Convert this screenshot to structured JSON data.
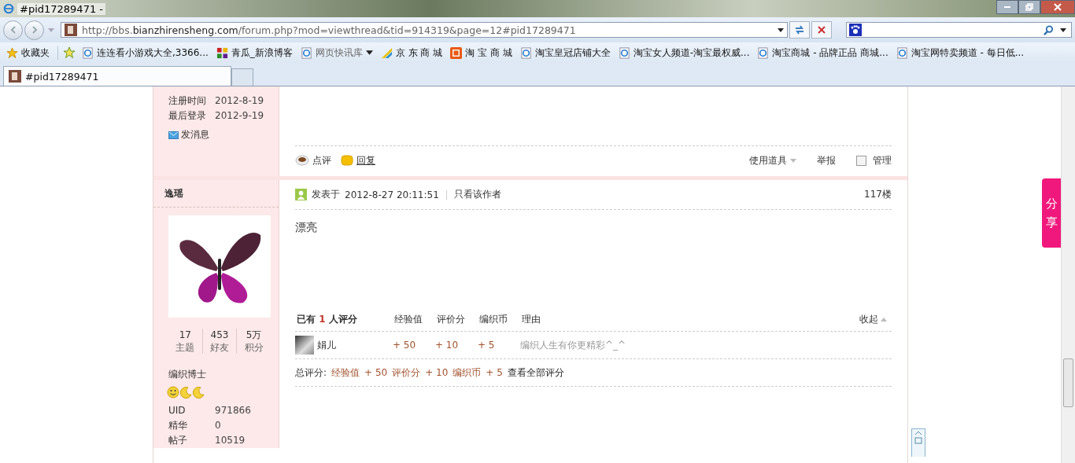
{
  "window": {
    "title": "#pid17289471 -"
  },
  "address_bar": {
    "url_prefix": "http://bbs.",
    "url_domain": "bianzhirensheng.com",
    "url_path": "/forum.php?mod=viewthread&tid=914319&page=12#pid17289471"
  },
  "favorites_bar": {
    "label": "收藏夹",
    "items": [
      {
        "kind": "page",
        "label": "连连看小游戏大全,3366..."
      },
      {
        "kind": "blocks",
        "label": "青瓜_新浪博客"
      },
      {
        "kind": "feed",
        "label": "网页快讯库"
      },
      {
        "kind": "stripes",
        "label": "京 东 商 城"
      },
      {
        "kind": "tao",
        "label": "淘 宝 商 城"
      },
      {
        "kind": "page",
        "label": "淘宝皇冠店铺大全"
      },
      {
        "kind": "page",
        "label": "淘宝女人频道-淘宝最权威..."
      },
      {
        "kind": "page",
        "label": "淘宝商城 - 品牌正品 商城..."
      },
      {
        "kind": "page",
        "label": "淘宝网特卖频道 - 每日低..."
      }
    ]
  },
  "tabs": [
    {
      "label": "#pid17289471",
      "selected": true
    }
  ],
  "previous_post": {
    "profile": [
      {
        "label": "注册时间",
        "value": "2012-8-19"
      },
      {
        "label": "最后登录",
        "value": "2012-9-19"
      }
    ],
    "message_link": "发消息",
    "actions": [
      {
        "kind": "comment",
        "label": "点评"
      },
      {
        "kind": "reply",
        "label": "回复"
      }
    ],
    "use_tool": "使用道具",
    "report": "举报",
    "manage": {
      "label": "管理",
      "checked": false
    }
  },
  "post": {
    "author": "逸瑶",
    "stats": [
      {
        "value": "17",
        "label": "主题"
      },
      {
        "value": "453",
        "label": "好友"
      },
      {
        "value": "5万",
        "label": "积分"
      }
    ],
    "rank": "编织博士",
    "profile": [
      {
        "label": "UID",
        "value": "971866"
      },
      {
        "label": "精华",
        "value": "0"
      },
      {
        "label": "帖子",
        "value": "10519"
      }
    ],
    "posted_label": "发表于",
    "posted_time": "2012-8-27 20:11:51",
    "author_only": "只看该作者",
    "floor": "117楼",
    "content": "漂亮",
    "rating": {
      "prefix": "已有",
      "count": "1",
      "suffix": "人评分",
      "columns": [
        "经验值",
        "评价分",
        "编织币",
        "理由"
      ],
      "collapse": "收起",
      "rows": [
        {
          "user": "娟儿",
          "values": [
            "+ 50",
            "+ 10",
            "+ 5"
          ],
          "reason": "编织人生有你更精彩^_^"
        }
      ],
      "total_label": "总评分:",
      "totals": [
        {
          "name": "经验值",
          "value": "+ 50"
        },
        {
          "name": "评价分",
          "value": "+ 10"
        },
        {
          "name": "编织币",
          "value": "+ 5"
        }
      ],
      "view_all": "查看全部评分"
    }
  },
  "share_button": "分享"
}
